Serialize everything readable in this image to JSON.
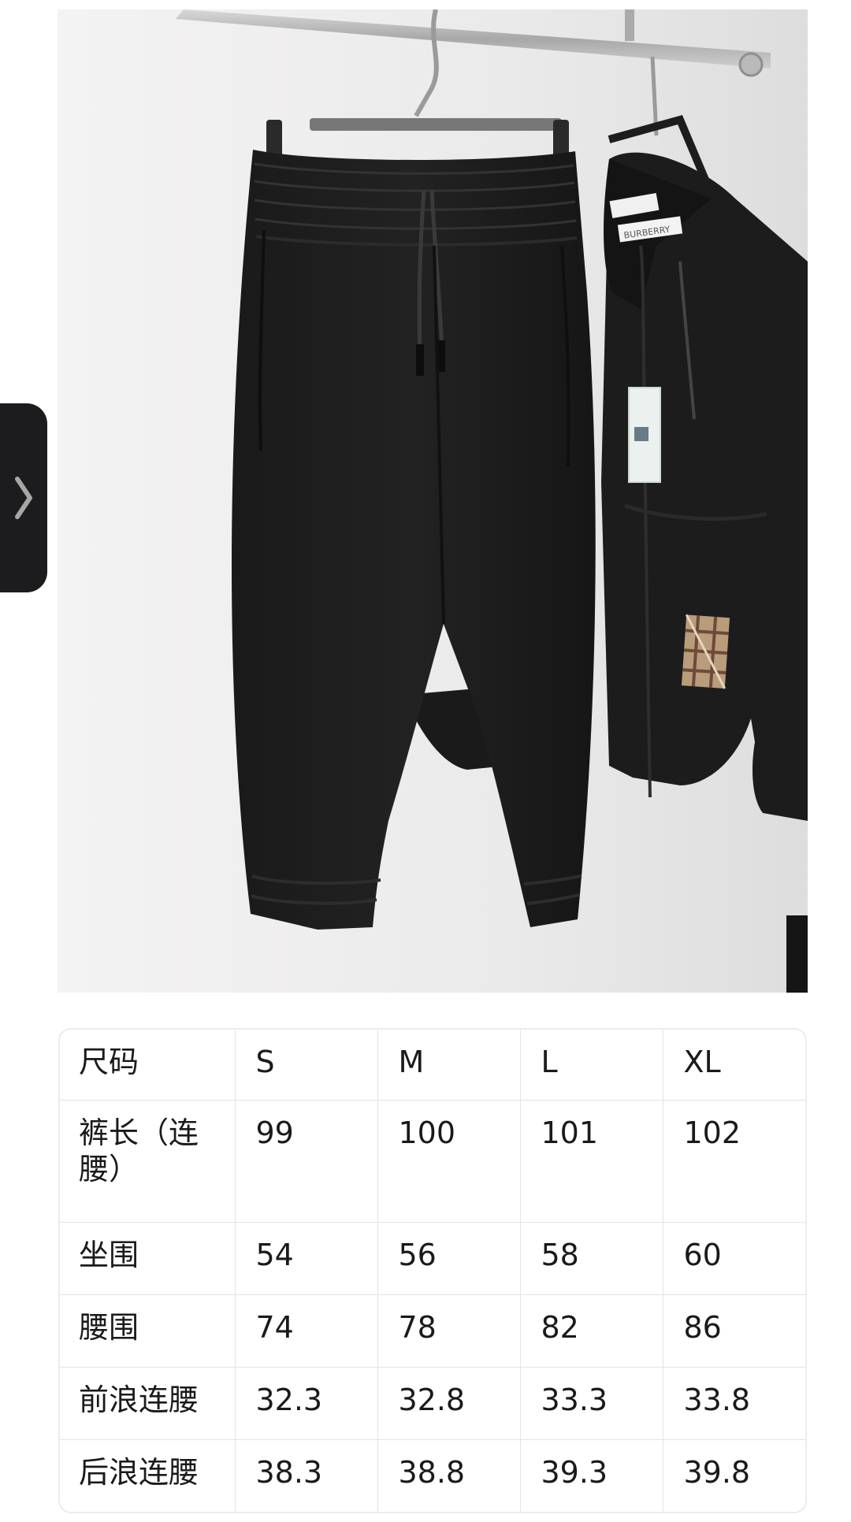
{
  "gallery": {
    "next_icon": "chevron-right-icon",
    "background_color": "#1c1c1e",
    "icon_color": "#a6a6a6"
  },
  "photo": {
    "hangtag_brand": "BURBERRY",
    "accent_color": "#111111"
  },
  "size_table": {
    "headers": [
      "尺码",
      "S",
      "M",
      "L",
      "XL"
    ],
    "rows": [
      {
        "label": "裤长（连腰）",
        "values": [
          "99",
          "100",
          "101",
          "102"
        ]
      },
      {
        "label": "坐围",
        "values": [
          "54",
          "56",
          "58",
          "60"
        ]
      },
      {
        "label": "腰围",
        "values": [
          "74",
          "78",
          "82",
          "86"
        ]
      },
      {
        "label": "前浪连腰",
        "values": [
          "32.3",
          "32.8",
          "33.3",
          "33.8"
        ]
      },
      {
        "label": "后浪连腰",
        "values": [
          "38.3",
          "38.8",
          "39.3",
          "39.8"
        ]
      }
    ]
  }
}
